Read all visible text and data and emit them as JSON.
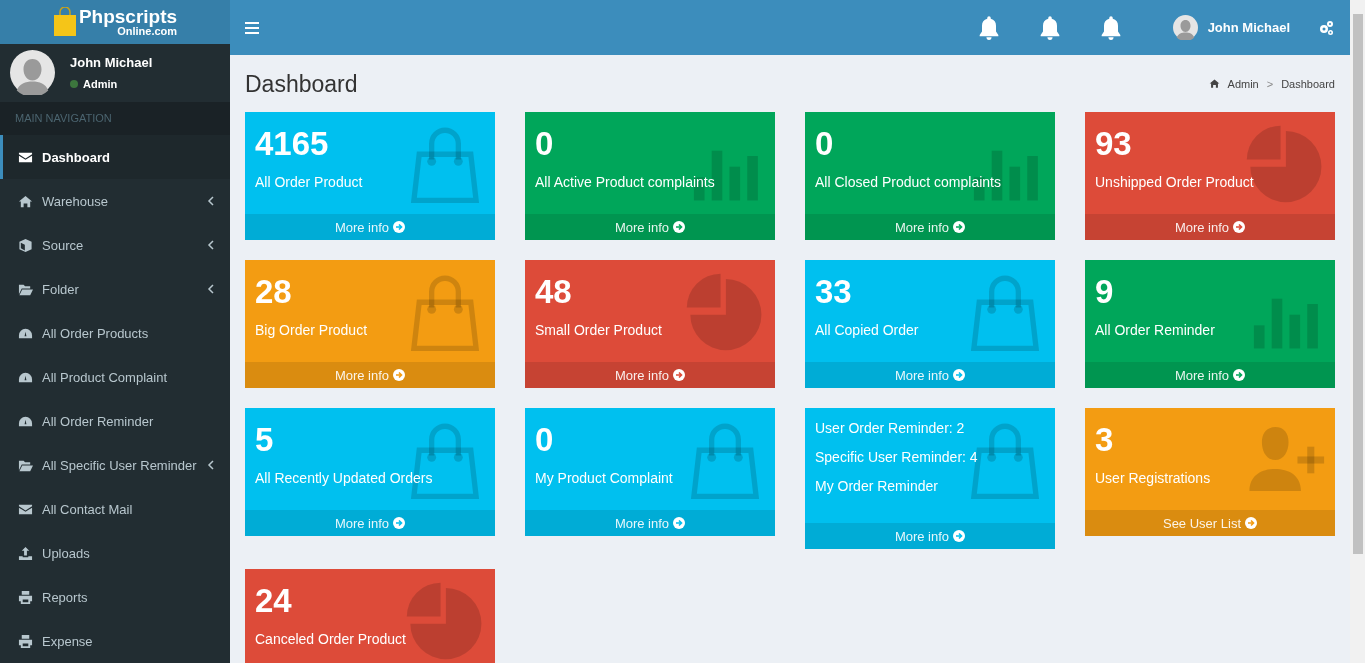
{
  "header": {
    "logo": {
      "brand": "Phpscripts",
      "domain": "Online.com"
    },
    "user_name": "John Michael"
  },
  "sidebar": {
    "user": {
      "name": "John Michael",
      "status": "Admin"
    },
    "section_title": "MAIN NAVIGATION",
    "items": [
      {
        "label": "Dashboard",
        "selected": true,
        "kind": "link"
      },
      {
        "label": "Warehouse",
        "selected": false,
        "kind": "tree"
      },
      {
        "label": "Source",
        "selected": false,
        "kind": "tree"
      },
      {
        "label": "Folder",
        "selected": false,
        "kind": "tree"
      },
      {
        "label": "All Order Products",
        "selected": false,
        "kind": "link"
      },
      {
        "label": "All Product Complaint",
        "selected": false,
        "kind": "link"
      },
      {
        "label": "All Order Reminder",
        "selected": false,
        "kind": "link"
      },
      {
        "label": "All Specific User Reminder",
        "selected": false,
        "kind": "tree"
      },
      {
        "label": "All Contact Mail",
        "selected": false,
        "kind": "link"
      },
      {
        "label": "Uploads",
        "selected": false,
        "kind": "link"
      },
      {
        "label": "Reports",
        "selected": false,
        "kind": "link"
      },
      {
        "label": "Expense",
        "selected": false,
        "kind": "link"
      }
    ]
  },
  "page": {
    "title": "Dashboard",
    "breadcrumb": {
      "items": [
        "Admin",
        "Dashboard"
      ],
      "separator": ">"
    }
  },
  "boxes": [
    {
      "kind": "stat",
      "value": "4165",
      "label": "All Order Product",
      "link": "More info",
      "color": "#00c0ef"
    },
    {
      "kind": "stat",
      "value": "0",
      "label": "All Active Product complaints",
      "link": "More info",
      "color": "#00a65a"
    },
    {
      "kind": "stat",
      "value": "0",
      "label": "All Closed Product complaints",
      "link": "More info",
      "color": "#00a65a"
    },
    {
      "kind": "stat",
      "value": "93",
      "label": "Unshipped Order Product",
      "link": "More info",
      "color": "#dd4b39"
    },
    {
      "kind": "stat",
      "value": "28",
      "label": "Big Order Product",
      "link": "More info",
      "color": "#f39c12"
    },
    {
      "kind": "stat",
      "value": "48",
      "label": "Small Order Product",
      "link": "More info",
      "color": "#dd4b39"
    },
    {
      "kind": "stat",
      "value": "33",
      "label": "All Copied Order",
      "link": "More info",
      "color": "#00c0ef"
    },
    {
      "kind": "stat",
      "value": "9",
      "label": "All Order Reminder",
      "link": "More info",
      "color": "#00a65a"
    },
    {
      "kind": "stat",
      "value": "5",
      "label": "All Recently Updated Orders",
      "link": "More info",
      "color": "#00c0ef"
    },
    {
      "kind": "stat",
      "value": "0",
      "label": "My Product Complaint",
      "link": "More info",
      "color": "#00c0ef"
    },
    {
      "kind": "list",
      "lines": [
        "User Order Reminder: 2",
        "Specific User Reminder: 4",
        "My Order Reminder"
      ],
      "link": "More info",
      "color": "#00c0ef"
    },
    {
      "kind": "stat",
      "value": "3",
      "label": "User Registrations",
      "link": "See User List",
      "color": "#f39c12"
    },
    {
      "kind": "stat",
      "value": "24",
      "label": "Canceled Order Product",
      "color": "#dd4b39"
    }
  ]
}
